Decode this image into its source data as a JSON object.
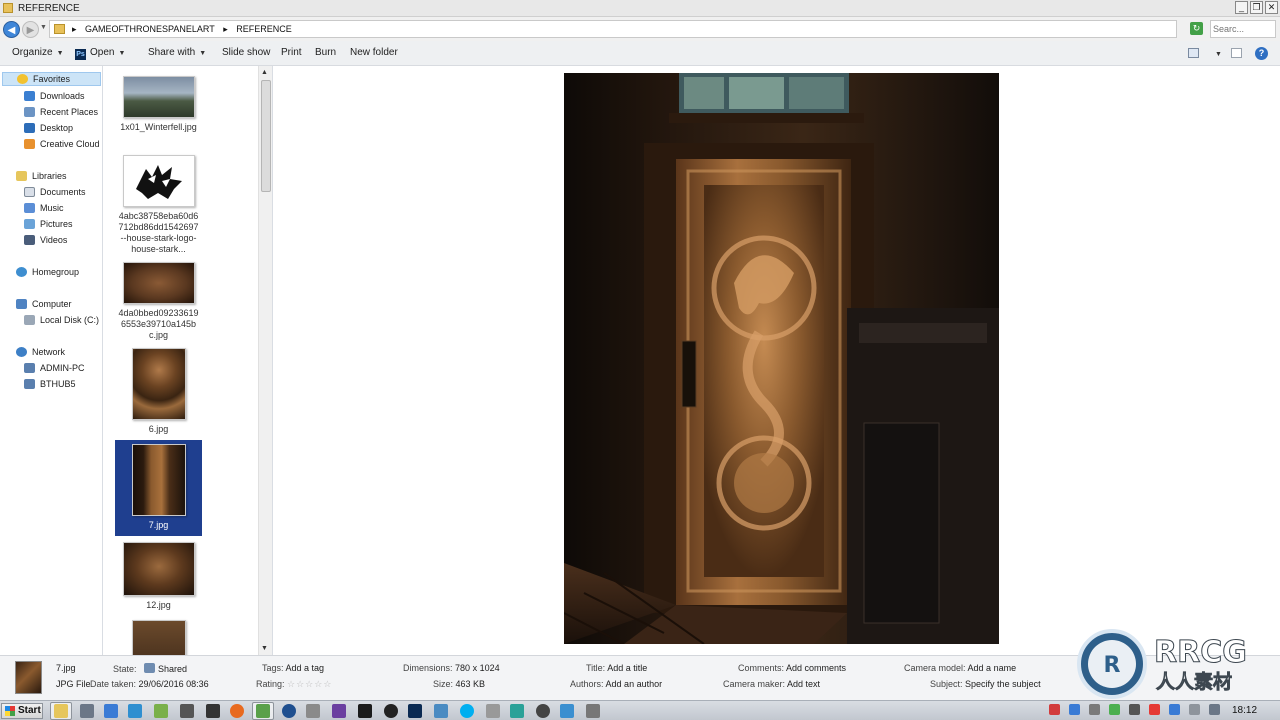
{
  "window": {
    "title": "REFERENCE",
    "controls": {
      "minimize": "_",
      "restore": "❐",
      "close": "✕"
    }
  },
  "address": {
    "crumbs": [
      "GAMEOFTHRONESPANELART",
      "REFERENCE"
    ],
    "separator": "▸",
    "search_placeholder": "Searc..."
  },
  "toolbar": {
    "organize": "Organize",
    "open": "Open",
    "share_with": "Share with",
    "slide_show": "Slide show",
    "print": "Print",
    "burn": "Burn",
    "new_folder": "New folder",
    "help": "?"
  },
  "nav": {
    "favorites": "Favorites",
    "downloads": "Downloads",
    "recent_places": "Recent Places",
    "desktop": "Desktop",
    "creative_cloud": "Creative Cloud",
    "libraries": "Libraries",
    "documents": "Documents",
    "music": "Music",
    "pictures": "Pictures",
    "videos": "Videos",
    "homegroup": "Homegroup",
    "computer": "Computer",
    "local_disk": "Local Disk (C:)",
    "network": "Network",
    "admin_pc": "ADMIN-PC",
    "bthub5": "BTHUB5"
  },
  "files": [
    {
      "name": "1x01_Winterfell.jpg"
    },
    {
      "name": "4abc38758eba60d6712bd86dd1542697--house-stark-logo-house-stark..."
    },
    {
      "name": "4da0bbed092336196553e39710a145bc.jpg"
    },
    {
      "name": "6.jpg"
    },
    {
      "name": "7.jpg",
      "selected": true
    },
    {
      "name": "12.jpg"
    }
  ],
  "details": {
    "file_name": "7.jpg",
    "file_type": "JPG File",
    "state_label": "State:",
    "state_value": "Shared",
    "date_taken_label": "Date taken:",
    "date_taken_value": "29/06/2016 08:36",
    "tags_label": "Tags:",
    "tags_value": "Add a tag",
    "rating_label": "Rating:",
    "rating_stars": "☆☆☆☆☆",
    "dimensions_label": "Dimensions:",
    "dimensions_value": "780 x 1024",
    "size_label": "Size:",
    "size_value": "463 KB",
    "title_label": "Title:",
    "title_value": "Add a title",
    "authors_label": "Authors:",
    "authors_value": "Add an author",
    "comments_label": "Comments:",
    "comments_value": "Add comments",
    "camera_maker_label": "Camera maker:",
    "camera_maker_value": "Add text",
    "camera_model_label": "Camera model:",
    "camera_model_value": "Add a name",
    "subject_label": "Subject:",
    "subject_value": "Specify the subject"
  },
  "watermark": {
    "brand": "RRCG",
    "subtitle": "人人素材"
  },
  "taskbar": {
    "start": "Start",
    "clock": "18:12"
  }
}
